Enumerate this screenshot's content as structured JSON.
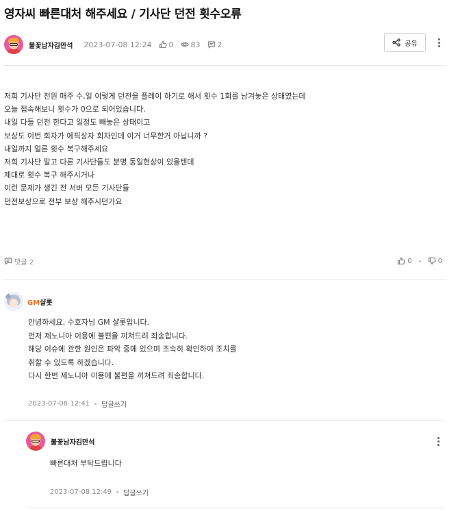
{
  "post": {
    "title": "영자씨 빠른대처 해주세요 / 기사단 던전 횟수오류",
    "author": "불꽃남자김만석",
    "date": "2023-07-08 12:24",
    "likes": "0",
    "views": "83",
    "comments": "2",
    "share_label": "공유",
    "body": [
      "저희 기사단 전원 매주 수,일 이렇게 던전을 플레이 하기로 해서 횟수 1회를 남겨놓은 상태였는데",
      "오늘 접속해보니 횟수가 0으로 되어있습니다.",
      "내일 다들 던전 한다고 일정도 빼놓은 상태이고",
      "보상도 이번 회차가 에픽상자 회차인데 이거 너무한거 아닙니까 ?",
      "내일까지 얼른 횟수 복구해주세요",
      "저희 기사단 말고 다른 기사단들도 분명 동일현상이 있을텐데",
      "제대로 횟수 복구 해주시거나",
      "이런 문제가 생긴 전 서버 모든 기사단들",
      "던전보상으로 전부 보상 해주시던가요"
    ],
    "footer": {
      "comment_label": "댓글 2",
      "like_count": "0",
      "dislike_count": "0"
    }
  },
  "comments": [
    {
      "badge": "GM",
      "name": "샬롯",
      "lines": [
        "안녕하세요, 수호자님 GM 샬롯입니다.",
        "먼저 제노니아 이용에 불편을 끼쳐드려 죄송합니다.",
        "해당 이슈에 관한 원인은 파악 중에 있으며 조속히 확인하여 조치를",
        "취할 수 있도록 하겠습니다.",
        "다시 한번 제노니아 이용에 불편을 끼쳐드려 죄송합니다."
      ],
      "date": "2023-07-08 12:41",
      "reply_label": "답글쓰기"
    },
    {
      "name": "불꽃남자김만석",
      "lines": [
        "빠른대처 부탁드립니다"
      ],
      "date": "2023-07-08 12:49",
      "reply_label": "답글쓰기"
    }
  ],
  "colors": {
    "gm_badge": "#f06a1a",
    "divider": "#e6e6e6",
    "muted_text": "#888888",
    "avatar_bg": "#e85a9b"
  },
  "icons": [
    "thumbs-up-icon",
    "eye-icon",
    "comment-icon",
    "share-icon",
    "more-icon",
    "thumbs-down-icon"
  ]
}
